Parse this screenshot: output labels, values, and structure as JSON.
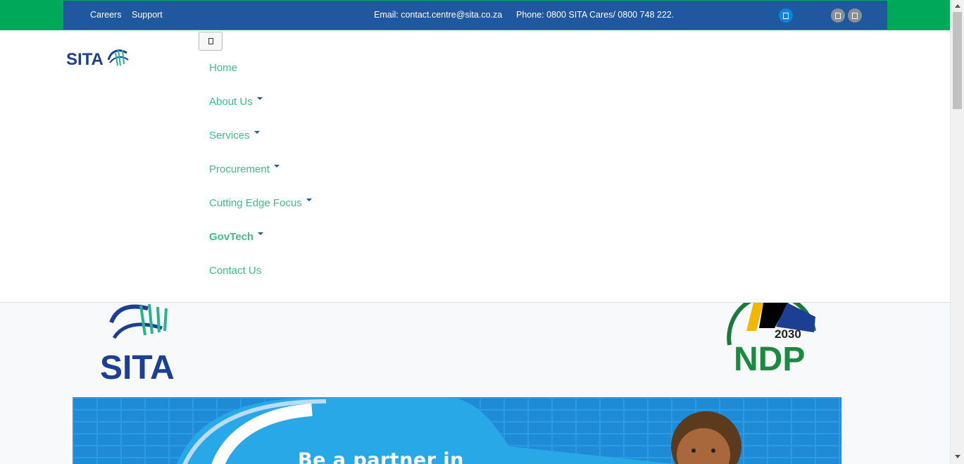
{
  "topbar": {
    "links": [
      {
        "label": "Careers"
      },
      {
        "label": "Support"
      }
    ],
    "email": "Email: contact.centre@sita.co.za",
    "phone": "Phone: 0800 SITA Cares/ 0800 748 222.",
    "social_icons": [
      "social-icon-blue",
      "social-icon-grey",
      "social-icon-grey"
    ]
  },
  "header": {
    "logo_text": "SITA",
    "toggler_icon": "menu-toggle-icon"
  },
  "nav": {
    "items": [
      {
        "label": "Home",
        "has_dropdown": false
      },
      {
        "label": "About Us",
        "has_dropdown": true
      },
      {
        "label": "Services",
        "has_dropdown": true
      },
      {
        "label": "Procurement",
        "has_dropdown": true
      },
      {
        "label": "Cutting Edge Focus",
        "has_dropdown": true
      },
      {
        "label": "GovTech",
        "has_dropdown": true,
        "bold": true
      },
      {
        "label": "Contact Us",
        "has_dropdown": false
      }
    ]
  },
  "content": {
    "logo_text": "SITA",
    "ndp_logo": {
      "year": "2030",
      "text": "NDP"
    },
    "banner": {
      "heading": "Be a partner in"
    }
  },
  "colors": {
    "topbar_green": "#00a859",
    "topbar_blue": "#2058a0",
    "nav_text": "#3dbd8a",
    "banner_blue": "#1f8bd7"
  }
}
